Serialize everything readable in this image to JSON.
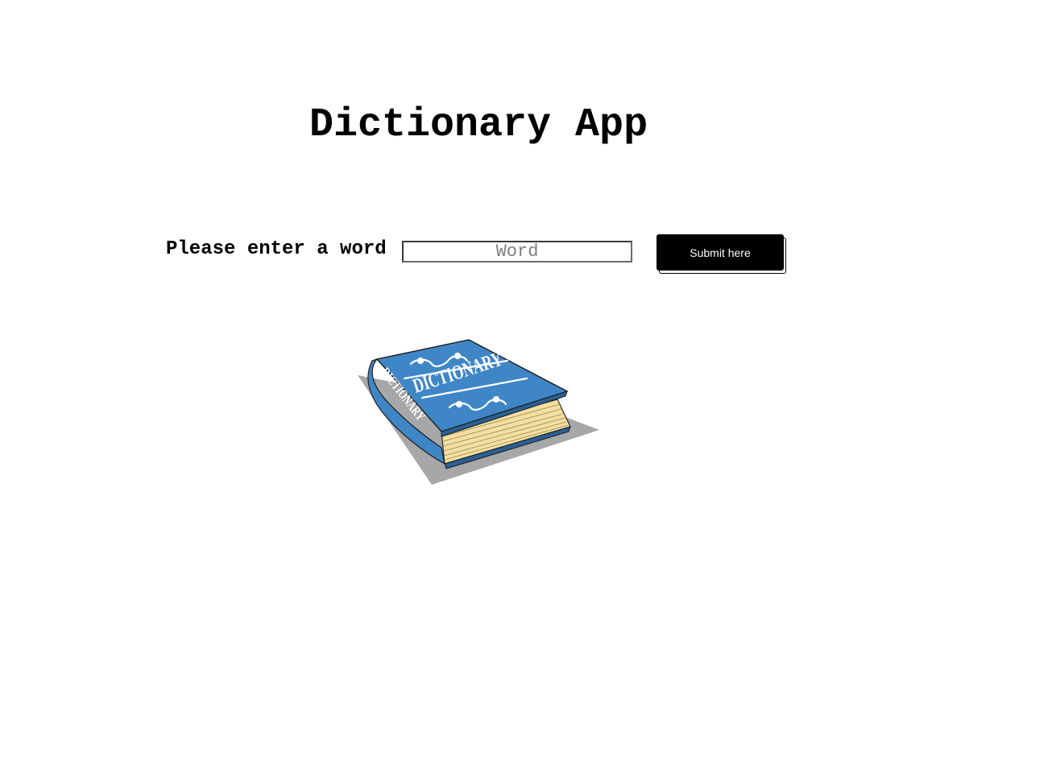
{
  "header": {
    "title": "Dictionary App"
  },
  "form": {
    "prompt_label": "Please enter a word",
    "input_value": "",
    "input_placeholder": "Word",
    "submit_label": "Submit here"
  },
  "illustration": {
    "icon": "dictionary-book-icon",
    "cover_text": "DICTIONARY",
    "spine_text": "DICTIONARY",
    "colors": {
      "cover": "#3f86c6",
      "cover_dark": "#2a5f94",
      "pages": "#f3dfa0",
      "shadow": "#a7a7a9",
      "ornament": "#ffffff"
    }
  }
}
